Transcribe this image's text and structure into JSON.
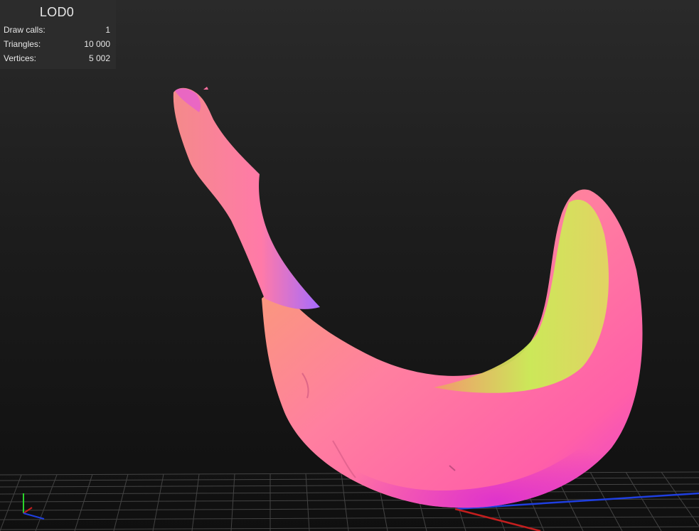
{
  "stats": {
    "title": "LOD0",
    "rows": [
      {
        "label": "Draw calls:",
        "value": "1"
      },
      {
        "label": "Triangles:",
        "value": "10 000"
      },
      {
        "label": "Vertices:",
        "value": "5 002"
      }
    ]
  },
  "colors": {
    "background_top": "#2a2a2a",
    "background_bottom": "#0f0f0f",
    "grid_line": "#6e6e6e",
    "axis_x": "#c41e1e",
    "axis_y": "#2ad42a",
    "axis_z": "#1f3fe0",
    "model_pink": "#ff6fa0",
    "model_magenta": "#e63fd0",
    "model_yellow": "#d8ef55",
    "model_orange": "#f7a56a"
  },
  "icons": {
    "axis_gizmo": "xyz-axis-gizmo-icon"
  }
}
